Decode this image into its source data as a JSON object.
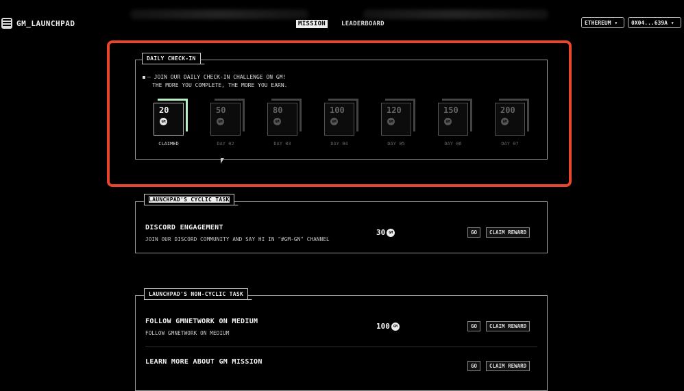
{
  "app": {
    "logo_text": "GM_LAUNCHPAD"
  },
  "nav": {
    "mission": "MISSION",
    "leaderboard": "LEADERBOARD"
  },
  "wallet": {
    "network": "ETHEREUM ▾",
    "address": "0X04...639A ▾"
  },
  "checkin": {
    "tab_label": "DAILY CHECK-IN",
    "intro_line1": "JOIN OUR DAILY CHECK-IN CHALLENGE ON GM!",
    "intro_line2": "THE MORE YOU COMPLETE, THE MORE YOU EARN.",
    "coin_label": "GM",
    "days": [
      {
        "amount": "20",
        "label": "CLAIMED",
        "claimed": true
      },
      {
        "amount": "50",
        "label": "DAY 02",
        "claimed": false
      },
      {
        "amount": "80",
        "label": "DAY 03",
        "claimed": false
      },
      {
        "amount": "100",
        "label": "DAY 04",
        "claimed": false
      },
      {
        "amount": "120",
        "label": "DAY 05",
        "claimed": false
      },
      {
        "amount": "150",
        "label": "DAY 06",
        "claimed": false
      },
      {
        "amount": "200",
        "label": "DAY 07",
        "claimed": false
      }
    ]
  },
  "cyclic": {
    "tab_label": "LAUNCHPAD'S CYCLIC TASK",
    "tasks": [
      {
        "title": "DISCORD ENGAGEMENT",
        "desc": "JOIN OUR DISCORD COMMUNITY AND SAY HI IN \"#GM-GN\" CHANNEL",
        "reward": "30",
        "go": "GO",
        "claim": "CLAIM REWARD"
      }
    ]
  },
  "noncyclic": {
    "tab_label": "LAUNCHPAD'S NON-CYCLIC TASK",
    "tasks": [
      {
        "title": "FOLLOW GMNETWORK ON MEDIUM",
        "desc": "FOLLOW GMNETWORK ON MEDIUM",
        "reward": "100",
        "go": "GO",
        "claim": "CLAIM REWARD"
      },
      {
        "title": "LEARN MORE ABOUT GM MISSION",
        "go": "GO",
        "claim": "CLAIM REWARD"
      }
    ]
  },
  "colors": {
    "highlight": "#e8452f",
    "claimed_accent": "#b8f0c8"
  }
}
